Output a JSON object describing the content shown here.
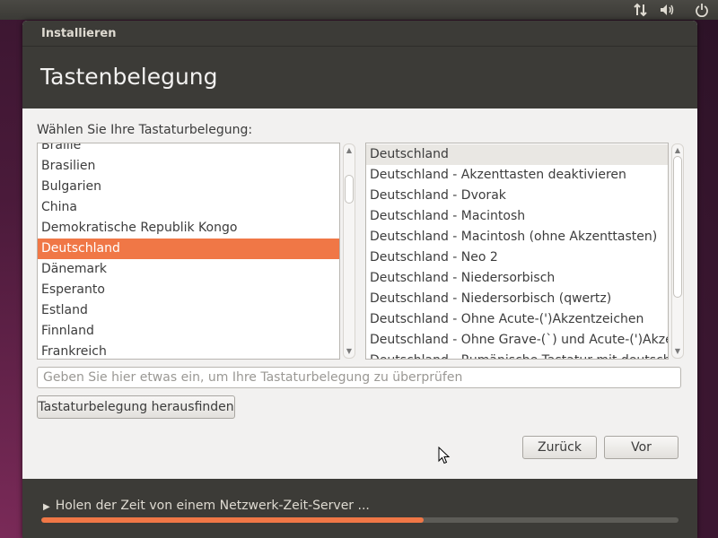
{
  "window": {
    "title": "Installieren",
    "page_title": "Tastenbelegung"
  },
  "prompt": "Wählen Sie Ihre Tastaturbelegung:",
  "layouts": [
    "Braille",
    "Brasilien",
    "Bulgarien",
    "China",
    "Demokratische Republik Kongo",
    "Deutschland",
    "Dänemark",
    "Esperanto",
    "Estland",
    "Finnland",
    "Frankreich"
  ],
  "layouts_selected": "Deutschland",
  "variants": [
    "Deutschland",
    "Deutschland - Akzenttasten deaktivieren",
    "Deutschland - Dvorak",
    "Deutschland - Macintosh",
    "Deutschland - Macintosh (ohne Akzenttasten)",
    "Deutschland - Neo 2",
    "Deutschland - Niedersorbisch",
    "Deutschland - Niedersorbisch (qwertz)",
    "Deutschland - Ohne Acute-(')Akzentzeichen",
    "Deutschland - Ohne Grave-(`) und Acute-(')Akzentzeichen",
    "Deutschland - Rumänische Tastatur mit deutschen Buchstaben"
  ],
  "variants_selected": "Deutschland",
  "test_input": {
    "placeholder": "Geben Sie hier etwas ein, um Ihre Tastaturbelegung zu überprüfen",
    "value": ""
  },
  "detect_button": "Tastaturbelegung herausfinden",
  "back_button": "Zurück",
  "next_button": "Vor",
  "status_text": "Holen der Zeit von einem Netzwerk-Zeit-Server ...",
  "progress": 0.6,
  "icons": {
    "network": "network-updown-icon",
    "volume": "volume-icon",
    "power": "power-icon",
    "status_arrow": "triangle-right-icon",
    "cursor": "mouse-pointer-icon"
  },
  "colors": {
    "accent": "#f07746",
    "header_bg": "#3c3b37",
    "window_bg": "#f2f1f0"
  }
}
